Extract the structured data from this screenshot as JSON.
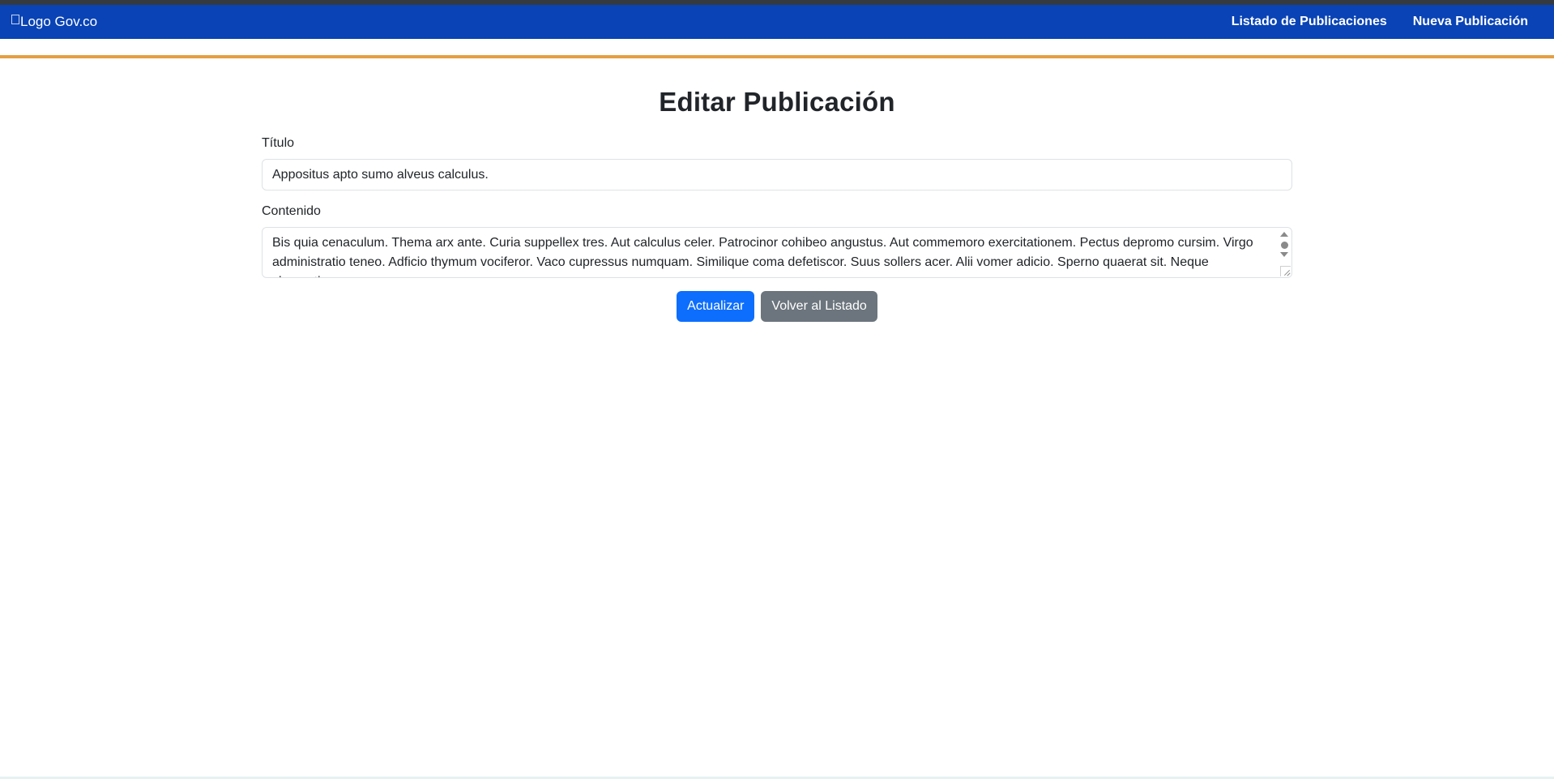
{
  "navbar": {
    "logo_alt": "Logo Gov.co",
    "links": [
      {
        "label": "Listado de Publicaciones"
      },
      {
        "label": "Nueva Publicación"
      }
    ]
  },
  "page": {
    "heading": "Editar Publicación"
  },
  "form": {
    "title_label": "Título",
    "title_value": "Appositus apto sumo alveus calculus.",
    "content_label": "Contenido",
    "content_value": "Bis quia cenaculum. Thema arx ante. Curia suppellex tres. Aut calculus celer. Patrocinor cohibeo angustus. Aut commemoro exercitationem. Pectus depromo cursim. Virgo administratio teneo. Adficio thymum vociferor. Vaco cupressus numquam. Similique coma defetiscor. Suus sollers acer. Alii vomer adicio. Sperno quaerat sit. Neque clementia",
    "update_button": "Actualizar",
    "back_button": "Volver al Listado"
  },
  "colors": {
    "navbar_bg": "#0943b5",
    "accent": "#e49f42",
    "primary": "#0d6efd",
    "secondary": "#6c757d"
  }
}
